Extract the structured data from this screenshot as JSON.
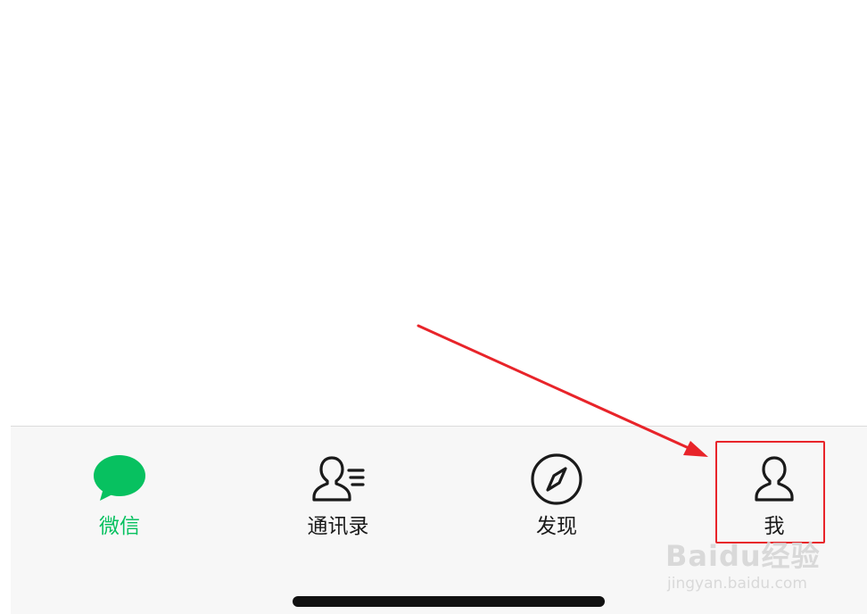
{
  "tabbar": {
    "tabs": [
      {
        "id": "chats",
        "label": "微信",
        "icon": "chat-bubble-icon",
        "active": true
      },
      {
        "id": "contacts",
        "label": "通讯录",
        "icon": "contacts-icon",
        "active": false
      },
      {
        "id": "discover",
        "label": "发现",
        "icon": "compass-icon",
        "active": false
      },
      {
        "id": "me",
        "label": "我",
        "icon": "person-icon",
        "active": false
      }
    ]
  },
  "colors": {
    "accent": "#07c160",
    "annotation": "#e8242a",
    "tabbar_bg": "#f7f7f7",
    "text": "#1a1a1a"
  },
  "annotation": {
    "target_tab": "me",
    "type": "red-arrow-and-box"
  },
  "watermark": {
    "logo_text": "Baidu经验",
    "url": "jingyan.baidu.com"
  }
}
